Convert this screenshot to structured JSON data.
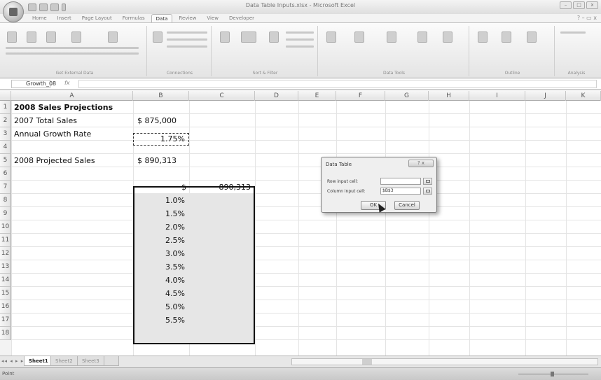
{
  "window": {
    "title": "Data Table Inputs.xlsx - Microsoft Excel"
  },
  "ribbon": {
    "tabs": [
      "Home",
      "Insert",
      "Page Layout",
      "Formulas",
      "Data",
      "Review",
      "View",
      "Developer"
    ],
    "active_tab": "Data",
    "groups": [
      "Get External Data",
      "Connections",
      "Sort & Filter",
      "Data Tools",
      "Outline",
      "Analysis"
    ]
  },
  "formula_bar": {
    "name_box": "Growth_08",
    "fx": "fx",
    "content": ""
  },
  "columns": [
    "A",
    "B",
    "C",
    "D",
    "E",
    "F",
    "G",
    "H",
    "I",
    "J",
    "K"
  ],
  "rows": [
    "1",
    "2",
    "3",
    "4",
    "5",
    "6",
    "7",
    "8",
    "9",
    "10",
    "11",
    "12",
    "13",
    "14",
    "15",
    "16",
    "17",
    "18"
  ],
  "cells": {
    "a1": "2008 Sales Projections",
    "a2": "2007 Total Sales",
    "b2": "$ 875,000",
    "a3": "Annual Growth Rate",
    "b3": "1.75%",
    "a5": "2008 Projected Sales",
    "b5": "$ 890,313",
    "b7_sym": "$",
    "c7": "890,313"
  },
  "rates": [
    "1.0%",
    "1.5%",
    "2.0%",
    "2.5%",
    "3.0%",
    "3.5%",
    "4.0%",
    "4.5%",
    "5.0%",
    "5.5%"
  ],
  "dialog": {
    "title": "Data Table",
    "row_label": "Row input cell:",
    "row_value": "",
    "col_label": "Column input cell:",
    "col_value": "$B$3",
    "ok": "OK",
    "cancel": "Cancel"
  },
  "sheets": {
    "active": "Sheet1",
    "others": [
      "Sheet2",
      "Sheet3"
    ]
  },
  "status": {
    "mode": "Point"
  }
}
